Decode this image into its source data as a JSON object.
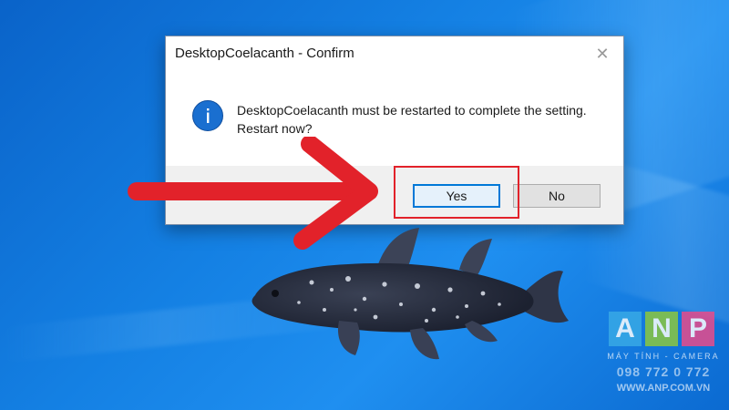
{
  "dialog": {
    "title": "DesktopCoelacanth - Confirm",
    "close_glyph": "✕",
    "icon": "info-icon",
    "message_line1": "DesktopCoelacanth must be restarted to complete the setting.",
    "message_line2": "Restart now?",
    "yes_label": "Yes",
    "no_label": "No"
  },
  "annotation": {
    "arrow_color": "#e2222a",
    "highlight_color": "#e2222a"
  },
  "watermark": {
    "tile_a": "A",
    "tile_n": "N",
    "tile_p": "P",
    "subtitle": "MÁY TÍNH - CAMERA",
    "phone": "098 772 0 772",
    "website": "WWW.ANP.COM.VN"
  },
  "theme": {
    "desktop_blue": "#1480e3",
    "accent": "#0078d7"
  }
}
